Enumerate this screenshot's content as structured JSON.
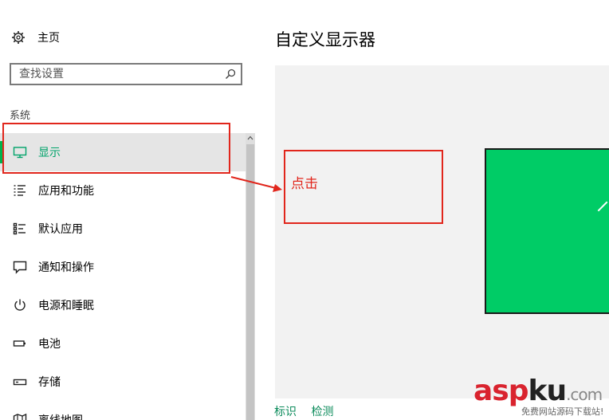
{
  "sidebar": {
    "home_label": "主页",
    "search_placeholder": "查找设置",
    "section_title": "系统",
    "items": [
      {
        "label": "显示",
        "icon": "monitor-icon"
      },
      {
        "label": "应用和功能",
        "icon": "list-icon"
      },
      {
        "label": "默认应用",
        "icon": "default-apps-icon"
      },
      {
        "label": "通知和操作",
        "icon": "notification-icon"
      },
      {
        "label": "电源和睡眠",
        "icon": "power-icon"
      },
      {
        "label": "电池",
        "icon": "battery-icon"
      },
      {
        "label": "存储",
        "icon": "storage-icon"
      },
      {
        "label": "离线地图",
        "icon": "map-icon"
      }
    ]
  },
  "main": {
    "title": "自定义显示器",
    "links": {
      "identify": "标识",
      "detect": "检测"
    }
  },
  "annotation": {
    "click_text": "点击"
  },
  "watermark": {
    "brand_a": "asp",
    "brand_b": "ku",
    "brand_c": ".com",
    "tagline": "免费网站源码下载站!"
  },
  "colors": {
    "accent": "#00b34f",
    "monitor": "#00cc66",
    "annotation": "#e1261c"
  }
}
